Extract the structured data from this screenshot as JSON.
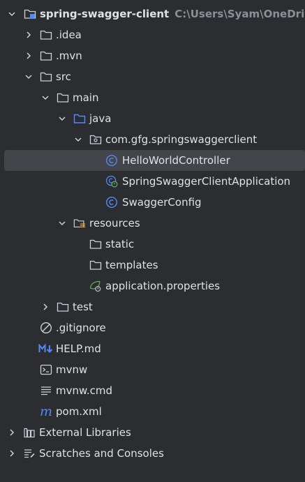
{
  "tree": {
    "root": {
      "label": "spring-swagger-client",
      "path": "C:\\Users\\Syam\\OneDrive"
    },
    "idea": ".idea",
    "mvn": ".mvn",
    "src": "src",
    "main": "main",
    "java": "java",
    "package": "com.gfg.springswaggerclient",
    "hello_controller": "HelloWorldController",
    "app_class": "SpringSwaggerClientApplication",
    "swagger_config": "SwaggerConfig",
    "resources": "resources",
    "static": "static",
    "templates": "templates",
    "app_properties": "application.properties",
    "test": "test",
    "gitignore": ".gitignore",
    "help_md": "HELP.md",
    "mvnw": "mvnw",
    "mvnw_cmd": "mvnw.cmd",
    "pom_xml": "pom.xml",
    "external_libraries": "External Libraries",
    "scratches": "Scratches and Consoles"
  },
  "colors": {
    "background": "#2b2d30",
    "selection": "#43454a",
    "text": "#dfe1e5",
    "muted_text": "#8c8f94",
    "folder_blue": "#548af7",
    "class_blue": "#548af7",
    "spring_green": "#5fb865",
    "markdown_blue": "#548af7",
    "maven_blue": "#548af7",
    "resource_orange": "#e7a33e"
  },
  "icons": {
    "expanded": "chevron-down-icon",
    "collapsed": "chevron-right-icon",
    "module": "module-folder-icon",
    "folder": "folder-icon",
    "source_folder": "source-folder-icon",
    "package": "package-icon",
    "class": "class-icon",
    "spring_app": "spring-boot-class-icon",
    "resources_folder": "resources-folder-icon",
    "properties": "spring-properties-icon",
    "ignore": "ignore-file-icon",
    "markdown": "markdown-icon",
    "terminal": "terminal-icon",
    "text": "text-file-icon",
    "maven": "maven-icon",
    "libraries": "libraries-icon",
    "scratches": "scratches-icon"
  }
}
